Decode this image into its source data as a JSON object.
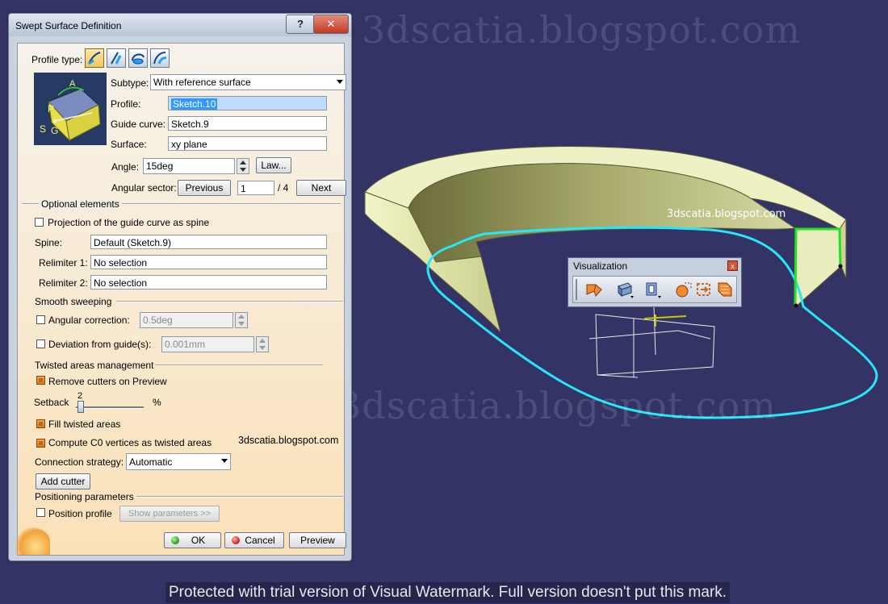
{
  "watermarks": {
    "big_top": "3dscatia.blogspot.com",
    "big_bottom": "3dscatia.blogspot.com",
    "small_view": "3dscatia.blogspot.com",
    "small_dialog": "3dscatia.blogspot.com",
    "trial_notice": "Protected with trial version of Visual Watermark. Full version doesn't put this mark."
  },
  "dialog": {
    "title": "Swept Surface Definition",
    "help_label": "?",
    "close_label": "✕",
    "profile_type_label": "Profile type:",
    "profile_types": [
      "explicit-profile-icon",
      "line-profile-icon",
      "circle-profile-icon",
      "conic-profile-icon"
    ],
    "subtype_label": "Subtype:",
    "subtype_value": "With reference surface",
    "profile_label": "Profile:",
    "profile_value": "Sketch.10",
    "guide_label": "Guide curve:",
    "guide_value": "Sketch.9",
    "surface_label": "Surface:",
    "surface_value": "xy plane",
    "angle_label": "Angle:",
    "angle_value": "15deg",
    "law_button": "Law...",
    "angular_sector_label": "Angular sector:",
    "previous_button": "Previous",
    "sector_value": "1",
    "sector_total": "/ 4",
    "next_button": "Next",
    "optional_title": "Optional elements",
    "projection_label": "Projection of the guide curve as spine",
    "spine_label": "Spine:",
    "spine_value": "Default (Sketch.9)",
    "relimiter1_label": "Relimiter 1:",
    "relimiter1_value": "No selection",
    "relimiter2_label": "Relimiter 2:",
    "relimiter2_value": "No selection",
    "smooth_title": "Smooth sweeping",
    "angular_correction_label": "Angular correction:",
    "angular_correction_value": "0.5deg",
    "deviation_label": "Deviation from guide(s):",
    "deviation_value": "0.001mm",
    "twisted_title": "Twisted areas management",
    "remove_cutters_label": "Remove cutters on Preview",
    "setback_label": "Setback",
    "setback_value": "2",
    "setback_unit": "%",
    "fill_twisted_label": "Fill twisted areas",
    "compute_c0_label": "Compute C0 vertices as twisted areas",
    "connection_label": "Connection strategy:",
    "connection_value": "Automatic",
    "add_cutter_button": "Add cutter",
    "positioning_title": "Positioning parameters",
    "position_profile_label": "Position profile",
    "show_parameters_button": "Show parameters >>",
    "ok_button": "OK",
    "cancel_button": "Cancel",
    "preview_button": "Preview"
  },
  "sketch_labels": {
    "a": "A",
    "p": "P",
    "s": "S",
    "g": "G"
  },
  "visualization": {
    "title": "Visualization",
    "close_label": "x",
    "icons": [
      "fly-mode-icon",
      "shading-icon",
      "view-mode-icon",
      "hide-show-icon",
      "swap-visible-icon",
      "quick-select-icon"
    ]
  },
  "colors": {
    "background": "#333366",
    "surface": "#e8ecb6",
    "guide_curve": "#22e0f0",
    "profile_curve": "#22e022"
  }
}
